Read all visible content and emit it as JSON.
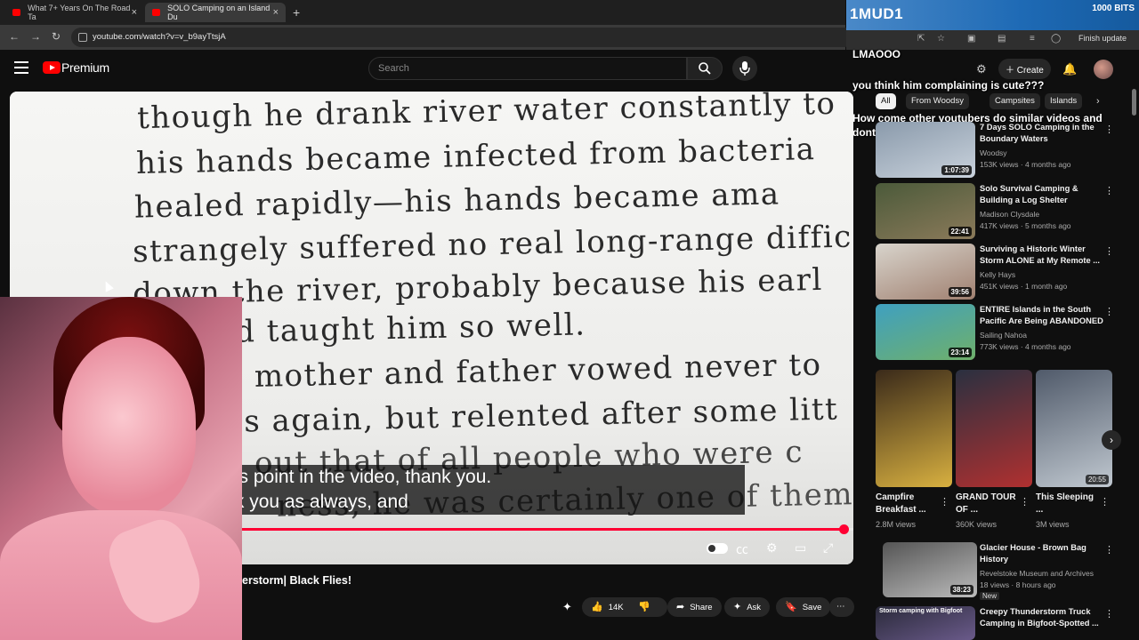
{
  "browser": {
    "tabs": [
      {
        "label": "What 7+ Years On The Road Ta"
      },
      {
        "label": "SOLO Camping on an Island Du"
      }
    ],
    "url": "youtube.com/watch?v=v_b9ayTtsjA"
  },
  "stream_overlay": {
    "bits_user": "1MUD1",
    "bits_amount": "1000 BITS",
    "finish_update": "Finish update",
    "chat": [
      {
        "text": "LMAOOO"
      },
      {
        "text": "you think him complaining is cute???"
      },
      {
        "text": "How come other youtubers do similar videos and dont get infected"
      }
    ]
  },
  "youtube": {
    "logo_text": "Premium",
    "search_placeholder": "Search",
    "create_label": "Create",
    "chips": [
      "All",
      "From Woodsy",
      "Campsites",
      "Islands"
    ]
  },
  "player": {
    "book_lines": [
      "though he drank river water constantly to",
      "his hands became infected from bacteria",
      "healed rapidly—his hands became ama",
      "strangely suffered no real long-range diffic",
      "down the river, probably because his earl",
      "had taught him so well.",
      "His mother and father vowed never to",
      "ods again, but relented after some litt",
      "out that of all people who were c",
      "ness, he was certainly one of them"
    ],
    "captions": [
      "to this point in the video, thank you.",
      "thank you as always, and"
    ],
    "progress": 0.988
  },
  "video": {
    "title_visible": "erstorm| Black Flies!",
    "like_count": "14K",
    "share_label": "Share",
    "ask_label": "Ask",
    "save_label": "Save"
  },
  "recommendations": [
    {
      "title": "7 Days SOLO Camping in the Boundary Waters",
      "channel": "Woodsy",
      "meta": "153K views · 4 months ago",
      "duration": "1:07:39",
      "colors": [
        "#8a9aab",
        "#c9d2dc"
      ]
    },
    {
      "title": "Solo Survival Camping & Building a Log Shelter",
      "channel": "Madison Clysdale",
      "meta": "417K views · 5 months ago",
      "duration": "22:41",
      "colors": [
        "#4b5a3a",
        "#8b7a5a"
      ]
    },
    {
      "title": "Surviving a Historic Winter Storm ALONE at My Remote ...",
      "channel": "Kelly Hays",
      "meta": "451K views · 1 month ago",
      "duration": "39:56",
      "colors": [
        "#d8d4cc",
        "#a08070"
      ]
    },
    {
      "title": "ENTIRE Islands in the South Pacific Are Being ABANDONED",
      "channel": "Sailing Nahoa",
      "meta": "773K views · 4 months ago",
      "duration": "23:14",
      "colors": [
        "#3fa0c0",
        "#6fb06a"
      ]
    }
  ],
  "shorts": [
    {
      "title": "Campfire Breakfast ...",
      "views": "2.8M views",
      "colors": [
        "#3a2a1a",
        "#d8b040"
      ]
    },
    {
      "title": "GRAND TOUR OF ...",
      "views": "360K views",
      "colors": [
        "#2a3040",
        "#b03030"
      ]
    },
    {
      "title": "This Sleeping ...",
      "views": "3M views",
      "duration": "20:55",
      "colors": [
        "#505a6a",
        "#c0c8d0"
      ]
    }
  ],
  "recommendations2": [
    {
      "title": "Glacier House - Brown Bag History",
      "channel": "Revelstoke Museum and Archives",
      "meta": "18 views · 8 hours ago",
      "badge": "New",
      "duration": "38:23",
      "colors": [
        "#555",
        "#bbb"
      ]
    },
    {
      "title": "Creepy Thunderstorm Truck Camping in Bigfoot-Spotted ...",
      "channel": "Roaming Reckless",
      "meta": "",
      "thumb_text": "Storm camping with Bigfoot",
      "colors": [
        "#2a2a3a",
        "#6a5a8a"
      ]
    }
  ]
}
